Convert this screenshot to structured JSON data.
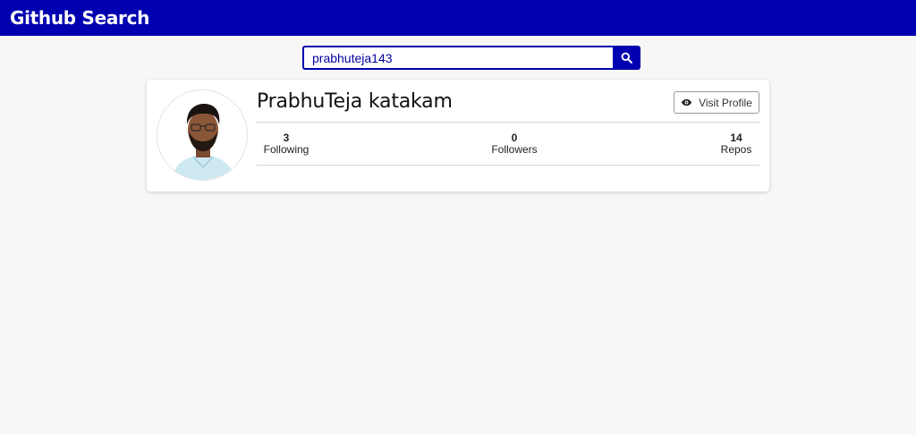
{
  "header": {
    "title": "Github Search",
    "color": "#0000b0"
  },
  "search": {
    "value": "prabhuteja143",
    "placeholder": "",
    "button_icon": "search-icon"
  },
  "profile": {
    "name": "PrabhuTeja katakam",
    "avatar_icon": "avatar-photo",
    "visit_button": {
      "label": "Visit Profile",
      "icon": "eye-icon"
    },
    "stats": {
      "following": {
        "value": "3",
        "label": "Following"
      },
      "followers": {
        "value": "0",
        "label": "Followers"
      },
      "repos": {
        "value": "14",
        "label": "Repos"
      }
    }
  }
}
